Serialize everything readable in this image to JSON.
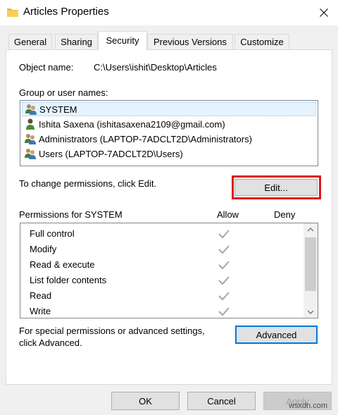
{
  "window": {
    "title": "Articles Properties",
    "icon": "folder-icon",
    "close_icon": "close-icon"
  },
  "tabs": [
    {
      "label": "General",
      "active": false
    },
    {
      "label": "Sharing",
      "active": false
    },
    {
      "label": "Security",
      "active": true
    },
    {
      "label": "Previous Versions",
      "active": false
    },
    {
      "label": "Customize",
      "active": false
    }
  ],
  "security": {
    "object_name_label": "Object name:",
    "object_name_value": "C:\\Users\\ishit\\Desktop\\Articles",
    "group_label": "Group or user names:",
    "users": [
      {
        "label": "SYSTEM",
        "icon": "group-users-icon",
        "selected": true
      },
      {
        "label": "Ishita Saxena (ishitasaxena2109@gmail.com)",
        "icon": "user-icon",
        "selected": false
      },
      {
        "label": "Administrators (LAPTOP-7ADCLT2D\\Administrators)",
        "icon": "group-users-icon",
        "selected": false
      },
      {
        "label": "Users (LAPTOP-7ADCLT2D\\Users)",
        "icon": "group-users-icon",
        "selected": false
      }
    ],
    "change_text": "To change permissions, click Edit.",
    "edit_button": "Edit...",
    "permissions_label": "Permissions for SYSTEM",
    "allow_header": "Allow",
    "deny_header": "Deny",
    "permissions": [
      {
        "name": "Full control",
        "allow": true,
        "deny": false
      },
      {
        "name": "Modify",
        "allow": true,
        "deny": false
      },
      {
        "name": "Read & execute",
        "allow": true,
        "deny": false
      },
      {
        "name": "List folder contents",
        "allow": true,
        "deny": false
      },
      {
        "name": "Read",
        "allow": true,
        "deny": false
      },
      {
        "name": "Write",
        "allow": true,
        "deny": false
      }
    ],
    "special_text_line1": "For special permissions or advanced settings,",
    "special_text_line2": "click Advanced.",
    "advanced_button": "Advanced"
  },
  "footer": {
    "ok": "OK",
    "cancel": "Cancel",
    "apply": "Apply"
  },
  "colors": {
    "highlight_box": "#e0141e",
    "checkmark_gray": "#a6a6a6",
    "selection": "#e5f3ff"
  },
  "watermark": "wsxdn.com"
}
